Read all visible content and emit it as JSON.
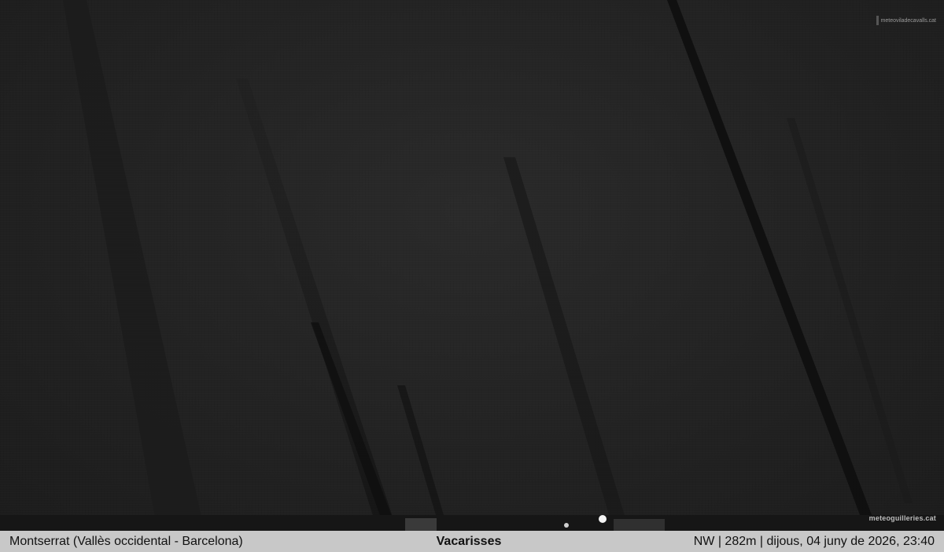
{
  "image": {
    "description_colors": {
      "sky": "#222222",
      "streak": "#121212",
      "light": "#f4f4f4",
      "bar_background": "#c8c8c8"
    },
    "watermark_top": "meteoviladecavalls.cat",
    "watermark_bottom": "meteoguilleries.cat"
  },
  "info_bar": {
    "location": "Montserrat (Vallès occidental - Barcelona)",
    "title": "Vacarisses",
    "details": "NW | 282m | dijous, 04 juny de 2026, 23:40"
  }
}
